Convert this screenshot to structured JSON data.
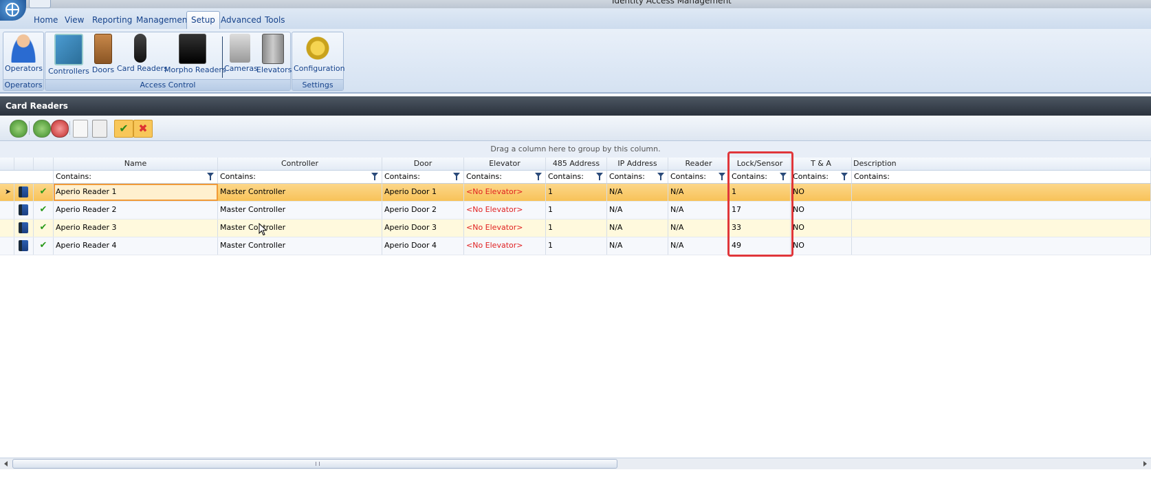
{
  "window": {
    "title": "Identity Access Management"
  },
  "ribbon": {
    "tabs": [
      "Home",
      "View",
      "Reporting",
      "Management",
      "Setup",
      "Advanced",
      "Tools"
    ],
    "active_tab": "Setup",
    "groups": [
      {
        "label": "Operators",
        "buttons": [
          {
            "label": "Operators",
            "icon": "operator-person-icon"
          }
        ]
      },
      {
        "label": "Access Control",
        "buttons": [
          {
            "label": "Controllers",
            "icon": "controller-board-icon"
          },
          {
            "label": "Doors",
            "icon": "door-icon"
          },
          {
            "label": "Card Readers",
            "icon": "card-reader-icon"
          },
          {
            "label": "Morpho Readers",
            "icon": "morpho-reader-icon"
          },
          {
            "label": "Cameras",
            "icon": "camera-icon"
          },
          {
            "label": "Elevators",
            "icon": "elevator-icon"
          }
        ]
      },
      {
        "label": "Settings",
        "buttons": [
          {
            "label": "Configuration",
            "icon": "gears-icon"
          }
        ]
      }
    ]
  },
  "panel": {
    "title": "Card Readers",
    "toolbar": {
      "icons": [
        "refresh-icon",
        "add-icon",
        "remove-icon",
        "edit-icon",
        "copy-icon",
        "accept-icon",
        "cancel-icon"
      ],
      "accept_glyph": "✔",
      "cancel_glyph": "✖"
    },
    "group_hint": "Drag a column here to group by this column."
  },
  "grid": {
    "columns": [
      "Name",
      "Controller",
      "Door",
      "Elevator",
      "485 Address",
      "IP Address",
      "Reader",
      "Lock/Sensor",
      "T & A",
      "Description"
    ],
    "filter_placeholder": "Contains:",
    "selected_row": 0,
    "rows": [
      {
        "indicator": "➤",
        "name": "Aperio Reader 1",
        "controller": "Master Controller",
        "door": "Aperio Door 1",
        "elevator": "<No Elevator>",
        "addr485": "1",
        "ip": "N/A",
        "reader": "N/A",
        "lock_sensor": "1",
        "ta": "NO",
        "description": ""
      },
      {
        "indicator": "",
        "name": "Aperio Reader 2",
        "controller": "Master Controller",
        "door": "Aperio Door 2",
        "elevator": "<No Elevator>",
        "addr485": "1",
        "ip": "N/A",
        "reader": "N/A",
        "lock_sensor": "17",
        "ta": "NO",
        "description": ""
      },
      {
        "indicator": "",
        "name": "Aperio Reader 3",
        "controller": "Master Controller",
        "door": "Aperio Door 3",
        "elevator": "<No Elevator>",
        "addr485": "1",
        "ip": "N/A",
        "reader": "N/A",
        "lock_sensor": "33",
        "ta": "NO",
        "description": ""
      },
      {
        "indicator": "",
        "name": "Aperio Reader 4",
        "controller": "Master Controller",
        "door": "Aperio Door 4",
        "elevator": "<No Elevator>",
        "addr485": "1",
        "ip": "N/A",
        "reader": "N/A",
        "lock_sensor": "49",
        "ta": "NO",
        "description": ""
      }
    ],
    "check_glyph": "✔"
  },
  "colors": {
    "highlight": "#e0363a",
    "elevator_text": "#e02020",
    "selected_row": "#f8c258",
    "panel_header": "#2a323c"
  }
}
